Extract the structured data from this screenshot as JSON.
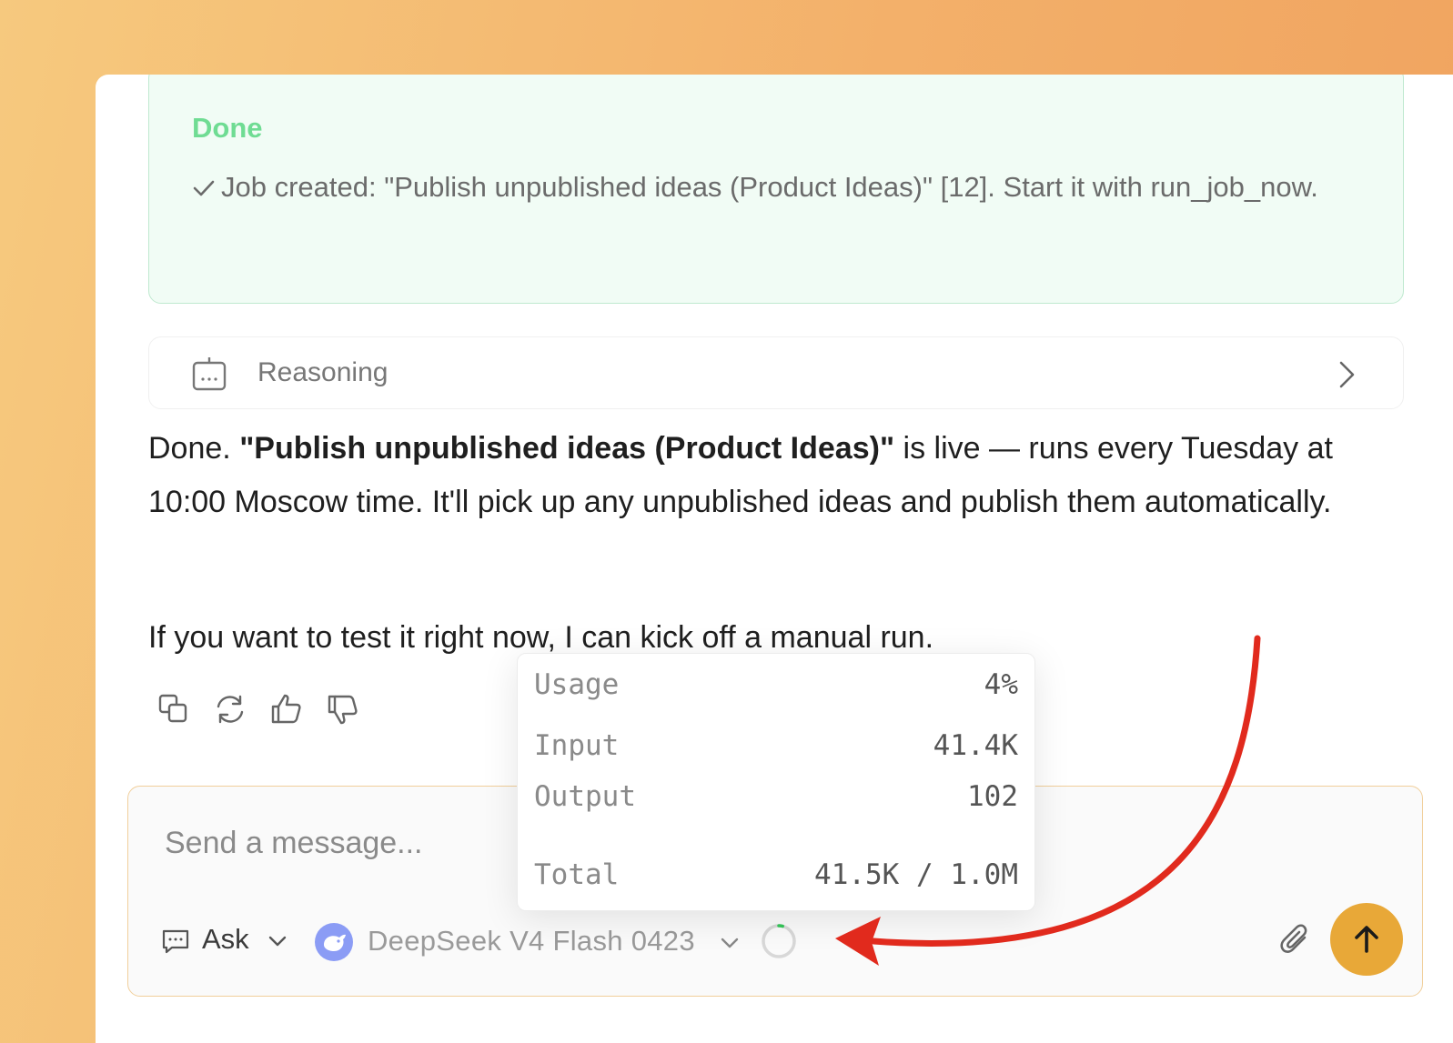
{
  "done_card": {
    "title": "Done",
    "check_icon": "check-icon",
    "text": "Job created: \"Publish unpublished ideas (Product Ideas)\" [12]. Start it with run_job_now."
  },
  "reasoning": {
    "label": "Reasoning",
    "icon": "robot-icon",
    "expand_icon": "chevron-right-icon"
  },
  "assistant_message": {
    "p1_prefix": "Done. ",
    "p1_bold": "\"Publish unpublished ideas (Product Ideas)\"",
    "p1_suffix": " is live — runs every Tuesday at 10:00 Moscow time. It'll pick up any unpublished ideas and publish them automatically.",
    "p2": "If you want to test it right now, I can kick off a manual run."
  },
  "message_actions": [
    "copy-icon",
    "regenerate-icon",
    "thumbs-up-icon",
    "thumbs-down-icon"
  ],
  "usage_popover": {
    "usage_label": "Usage",
    "usage_value": "4%",
    "input_label": "Input",
    "input_value": "41.4K",
    "output_label": "Output",
    "output_value": "102",
    "total_label": "Total",
    "total_value": "41.5K / 1.0M",
    "usage_fraction": 0.04
  },
  "composer": {
    "placeholder": "Send a message...",
    "mode_label": "Ask",
    "model_label": "DeepSeek V4 Flash 0423"
  },
  "colors": {
    "accent": "#e8a838",
    "done_green": "#6fdc93",
    "annotation_red": "#e12a1d"
  }
}
